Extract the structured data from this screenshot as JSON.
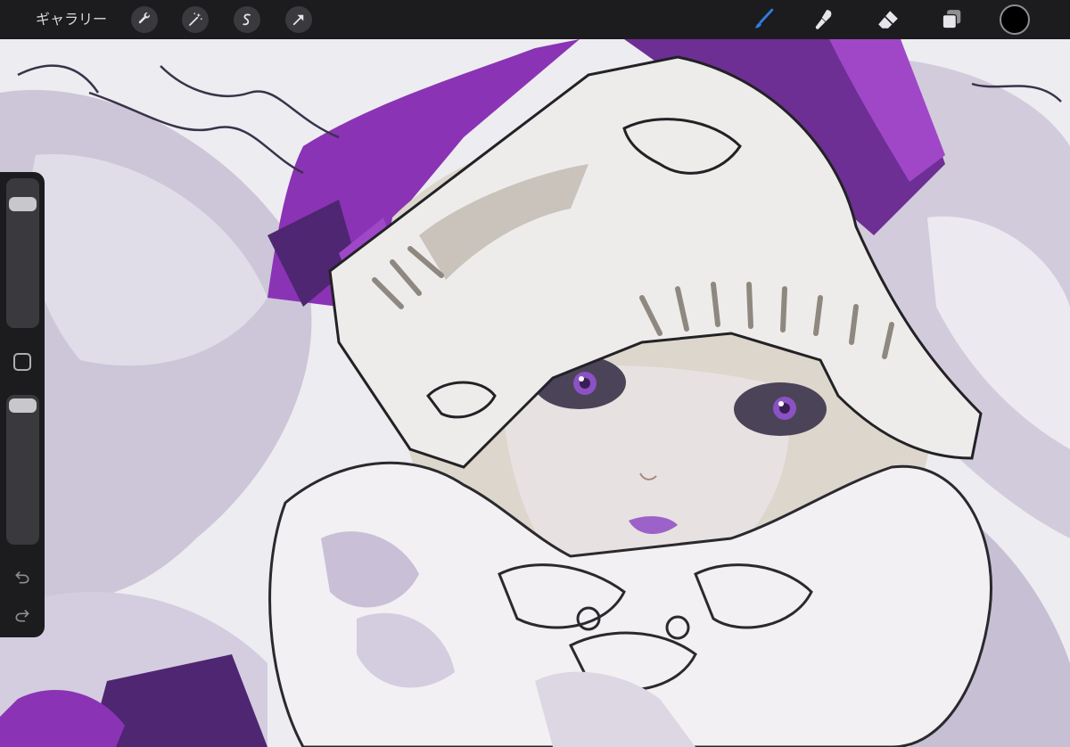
{
  "toolbar": {
    "gallery_label": "ギャラリー",
    "left_tools": [
      "wrench-icon",
      "magic-wand-icon",
      "selection-icon",
      "transform-arrow-icon"
    ],
    "right_tools": [
      "brush-icon",
      "smudge-icon",
      "eraser-icon",
      "layers-icon"
    ],
    "active_tool": "brush-icon",
    "current_color": "#000000",
    "accent_color": "#2f7de1"
  },
  "sidebar": {
    "brush_size_level": 0.12,
    "opacity_level": 0.0,
    "icons": [
      "modifier-square-icon",
      "undo-icon",
      "redo-icon"
    ]
  },
  "canvas": {
    "palette": [
      "#8a33b5",
      "#4e2672",
      "#d9d5e2",
      "#bcb3cc",
      "#f3f1f5",
      "#a047c8"
    ]
  }
}
